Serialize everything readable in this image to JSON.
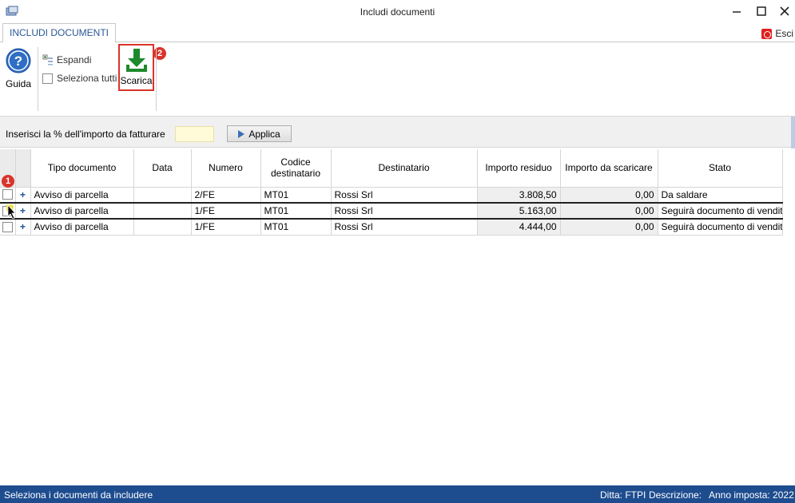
{
  "window": {
    "title": "Includi documenti"
  },
  "ribbon": {
    "tab_label": "INCLUDI DOCUMENTI",
    "exit_label": "Esci",
    "guida_label": "Guida",
    "espandi_label": "Espandi",
    "seleziona_tutti_label": "Seleziona tutti",
    "scarica_label": "Scarica",
    "badge_scarica": "2",
    "badge_row": "1"
  },
  "percent_bar": {
    "label": "Inserisci la % dell'importo da fatturare",
    "input_value": "",
    "apply_label": "Applica"
  },
  "grid": {
    "columns": [
      "Tipo documento",
      "Data",
      "Numero",
      "Codice destinatario",
      "Destinatario",
      "Importo residuo",
      "Importo da scaricare",
      "Stato"
    ],
    "rows": [
      {
        "tipo": "Avviso di parcella",
        "data": "",
        "numero": "2/FE",
        "codice": "MT01",
        "destinatario": "Rossi Srl",
        "residuo": "3.808,50",
        "scaricare": "0,00",
        "stato": "Da saldare"
      },
      {
        "tipo": "Avviso di parcella",
        "data": "",
        "numero": "1/FE",
        "codice": "MT01",
        "destinatario": "Rossi Srl",
        "residuo": "5.163,00",
        "scaricare": "0,00",
        "stato": "Seguirà documento di vendita"
      },
      {
        "tipo": "Avviso di parcella",
        "data": "",
        "numero": "1/FE",
        "codice": "MT01",
        "destinatario": "Rossi Srl",
        "residuo": "4.444,00",
        "scaricare": "0,00",
        "stato": "Seguirà documento di vendita"
      }
    ],
    "expand_symbol": "+"
  },
  "statusbar": {
    "message": "Seleziona i documenti da includere",
    "ditta": "Ditta: FTPI",
    "descrizione": "Descrizione:",
    "anno": "Anno imposta: 2022"
  },
  "colors": {
    "accent_blue": "#1e4d8f",
    "highlight_red": "#d9342b",
    "input_yellow": "#fffbd8"
  }
}
